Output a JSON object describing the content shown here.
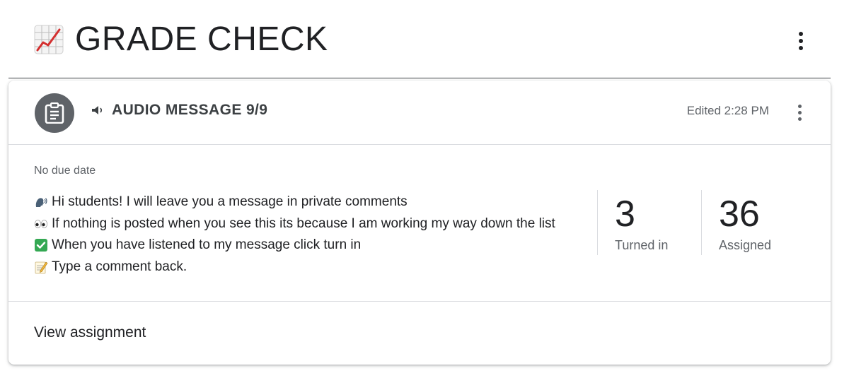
{
  "topic": {
    "icon": "chart-increasing-icon",
    "title": "GRADE CHECK"
  },
  "assignment": {
    "icon": "assignment-clipboard-icon",
    "title_icon": "speaker-icon",
    "title": "AUDIO MESSAGE 9/9",
    "edited": "Edited 2:28 PM",
    "due_date": "No due date",
    "instructions": [
      {
        "icon": "speaking-head-icon",
        "text": "Hi students! I will leave you a message in private comments"
      },
      {
        "icon": "eyes-icon",
        "text": "If nothing is posted when you see this its because I am working my way down the list"
      },
      {
        "icon": "check-mark-button-icon",
        "text": "When you have listened to my message click turn in"
      },
      {
        "icon": "memo-icon",
        "text": "Type a comment back."
      }
    ],
    "stats": [
      {
        "value": "3",
        "label": "Turned in"
      },
      {
        "value": "36",
        "label": "Assigned"
      }
    ],
    "view_label": "View assignment"
  },
  "colors": {
    "icon_circle": "#5f6368",
    "text_primary": "#202124",
    "text_secondary": "#5f6368",
    "divider": "#dadce0",
    "check_green": "#34a853"
  }
}
